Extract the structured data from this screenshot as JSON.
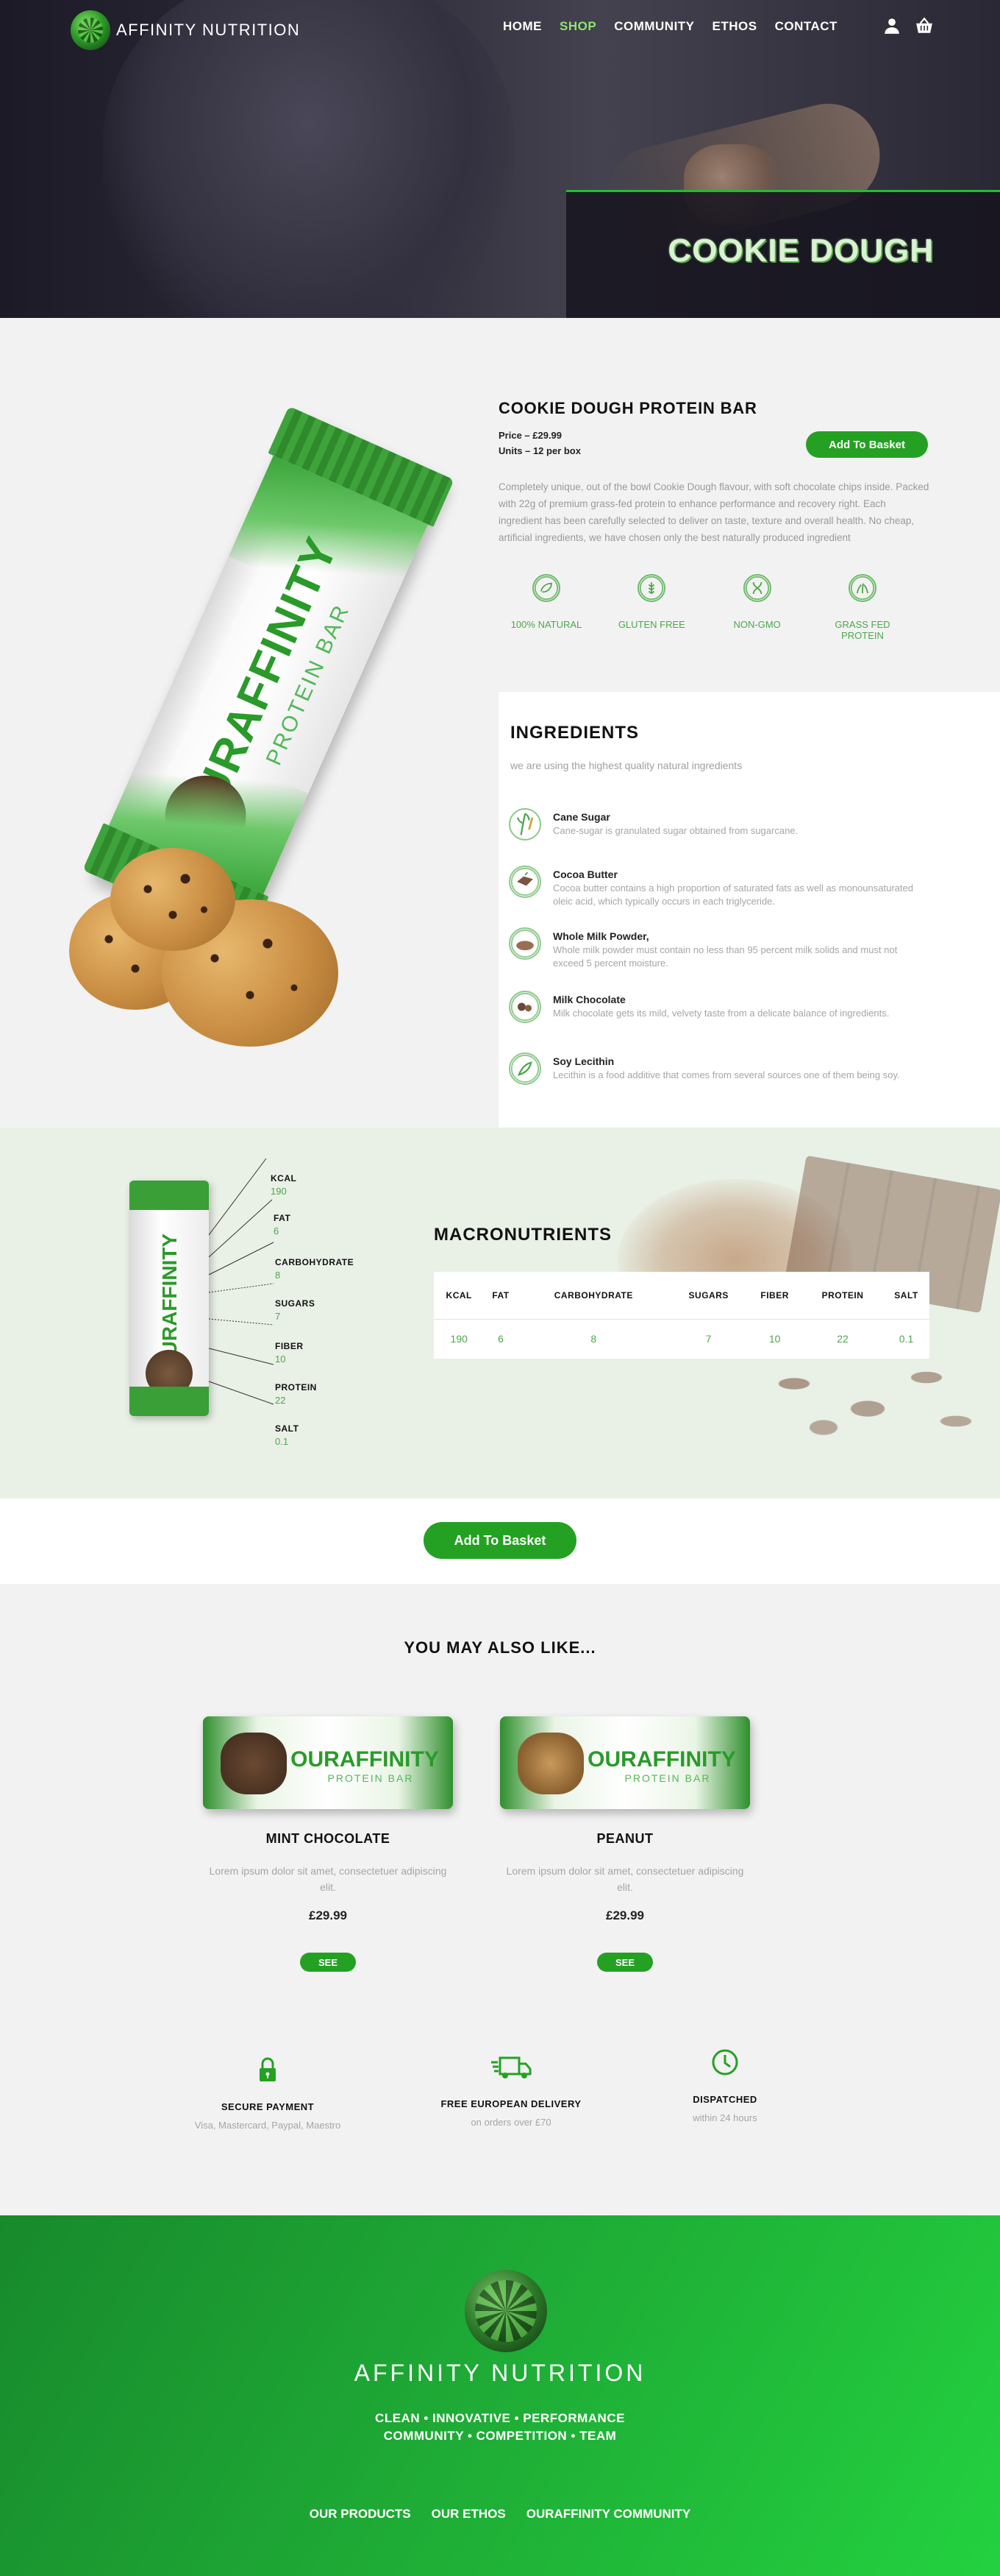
{
  "brand": "AFFINITY NUTRITION",
  "nav": {
    "links": [
      "HOME",
      "SHOP",
      "COMMUNITY",
      "ETHOS",
      "CONTACT"
    ],
    "active": "SHOP",
    "icons": [
      "user-icon",
      "basket-icon"
    ]
  },
  "hero": {
    "title": "COOKIE DOUGH"
  },
  "product": {
    "title": "COOKIE DOUGH PROTEIN BAR",
    "price": "Price – £29.99",
    "units": "Units – 12 per box",
    "add_to_basket": "Add To Basket",
    "description": "Completely unique, out of the bowl Cookie Dough flavour, with soft chocolate chips inside. Packed with  22g of premium grass-fed protein to enhance performance and recovery right. Each ingredient has been carefully selected to deliver on taste, texture and overall health. No cheap, artificial ingredients, we have chosen only the best  naturally produced ingredient",
    "features": [
      "100% NATURAL",
      "GLUTEN FREE",
      "NON-GMO",
      "GRASS FED PROTEIN"
    ],
    "packaging": {
      "brand": "OURAFFINITY",
      "subtitle": "PROTEIN BAR"
    }
  },
  "ingredients": {
    "title": "INGREDIENTS",
    "subtitle": "we are using the highest quality natural ingredients",
    "items": [
      {
        "name": "Cane Sugar",
        "desc": "Cane-sugar is granulated sugar obtained from sugarcane."
      },
      {
        "name": "Cocoa Butter",
        "desc": "Cocoa butter contains a high proportion of saturated fats as well as monounsaturated oleic acid, which typically occurs in each triglyceride."
      },
      {
        "name": "Whole Milk Powder,",
        "desc": "Whole milk powder must contain no less than 95 percent milk solids and must not exceed 5 percent moisture."
      },
      {
        "name": "Milk Chocolate",
        "desc": "Milk chocolate gets its mild, velvety taste from a delicate balance of ingredients."
      },
      {
        "name": "Soy Lecithin",
        "desc": "Lecithin is a food additive that comes from several sources  one of them being soy."
      }
    ]
  },
  "macros": {
    "title": "MACRONUTRIENTS",
    "headers": [
      "KCAL",
      "FAT",
      "CARBOHYDRATE",
      "SUGARS",
      "FIBER",
      "PROTEIN",
      "SALT"
    ],
    "values": [
      "190",
      "6",
      "8",
      "7",
      "10",
      "22",
      "0.1"
    ],
    "labels": [
      {
        "name": "KCAL",
        "value": "190"
      },
      {
        "name": "FAT",
        "value": "6"
      },
      {
        "name": "CARBOHYDRATE",
        "value": "8"
      },
      {
        "name": "SUGARS",
        "value": "7"
      },
      {
        "name": "FIBER",
        "value": "10"
      },
      {
        "name": "PROTEIN",
        "value": "22"
      },
      {
        "name": "SALT",
        "value": "0.1"
      }
    ]
  },
  "basket2": "Add To Basket",
  "also": {
    "title": "YOU MAY ALSO LIKE...",
    "items": [
      {
        "name": "MINT CHOCOLATE",
        "desc": "Lorem ipsum dolor sit amet, consectetuer adipiscing elit.",
        "price": "£29.99",
        "cta": "SEE"
      },
      {
        "name": "PEANUT",
        "desc": "Lorem ipsum dolor sit amet, consectetuer adipiscing elit.",
        "price": "£29.99",
        "cta": "SEE"
      }
    ]
  },
  "perks": [
    {
      "icon": "lock-icon",
      "title": "SECURE PAYMENT",
      "sub": "Visa, Mastercard, Paypal, Maestro"
    },
    {
      "icon": "truck-icon",
      "title": "FREE EUROPEAN DELIVERY",
      "sub": "on orders over £70"
    },
    {
      "icon": "clock-icon",
      "title": "DISPATCHED",
      "sub": "within 24 hours"
    }
  ],
  "footer": {
    "brand": "AFFINITY NUTRITION",
    "tag1": "CLEAN • INNOVATIVE • PERFORMANCE",
    "tag2": "COMMUNITY • COMPETITION • TEAM",
    "links": [
      "OUR PRODUCTS",
      "OUR ETHOS",
      "OURAFFINITY COMMUNITY"
    ]
  },
  "colors": {
    "accent": "#24a123",
    "accent_light": "#4da74a",
    "nav_active": "#8ee66f",
    "footer_start": "#188a2c",
    "footer_end": "#23d13f"
  }
}
